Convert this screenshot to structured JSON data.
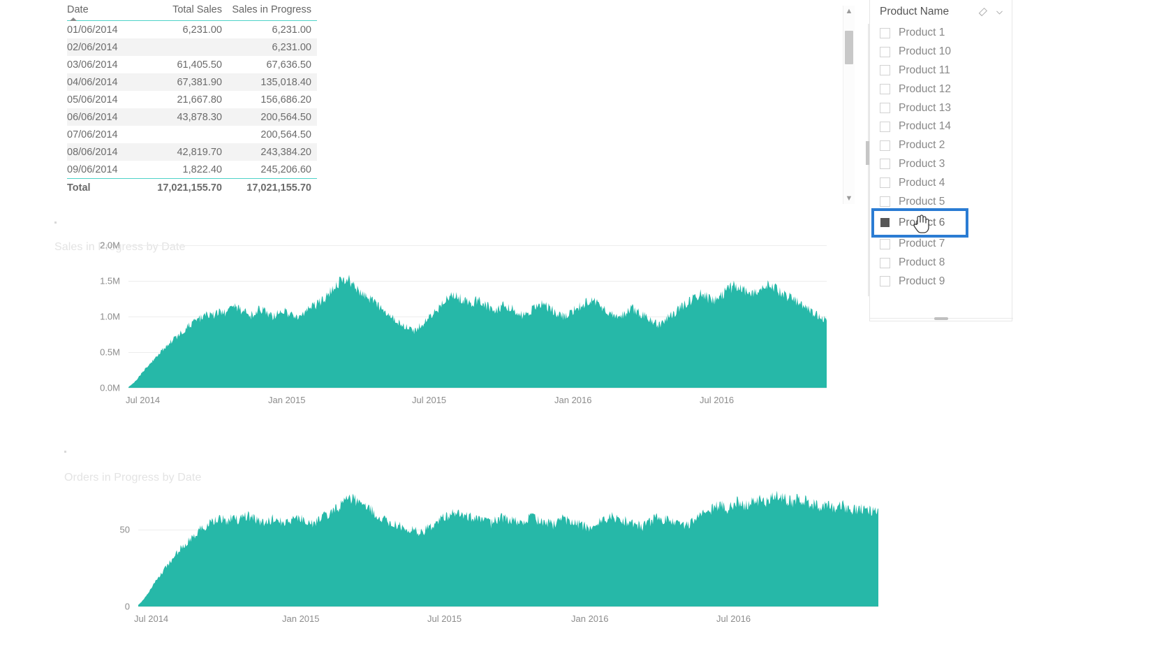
{
  "table": {
    "name": "sales-detail-table",
    "columns": [
      "Date",
      "Total Sales",
      "Sales in Progress"
    ],
    "rows": [
      {
        "date": "01/06/2014",
        "total_sales": "6,231.00",
        "sales_in_progress": "6,231.00"
      },
      {
        "date": "02/06/2014",
        "total_sales": "",
        "sales_in_progress": "6,231.00"
      },
      {
        "date": "03/06/2014",
        "total_sales": "61,405.50",
        "sales_in_progress": "67,636.50"
      },
      {
        "date": "04/06/2014",
        "total_sales": "67,381.90",
        "sales_in_progress": "135,018.40"
      },
      {
        "date": "05/06/2014",
        "total_sales": "21,667.80",
        "sales_in_progress": "156,686.20"
      },
      {
        "date": "06/06/2014",
        "total_sales": "43,878.30",
        "sales_in_progress": "200,564.50"
      },
      {
        "date": "07/06/2014",
        "total_sales": "",
        "sales_in_progress": "200,564.50"
      },
      {
        "date": "08/06/2014",
        "total_sales": "42,819.70",
        "sales_in_progress": "243,384.20"
      },
      {
        "date": "09/06/2014",
        "total_sales": "1,822.40",
        "sales_in_progress": "245,206.60"
      }
    ],
    "footer": {
      "label": "Total",
      "total_sales": "17,021,155.70",
      "sales_in_progress": "17,021,155.70"
    },
    "sort_column": "Date",
    "sort_direction": "ascending"
  },
  "slicer": {
    "title": "Product Name",
    "clear_icon": "eraser-icon",
    "expand_icon": "chevron-down-icon",
    "items": [
      {
        "label": "Product 1",
        "selected": false
      },
      {
        "label": "Product 10",
        "selected": false
      },
      {
        "label": "Product 11",
        "selected": false
      },
      {
        "label": "Product 12",
        "selected": false
      },
      {
        "label": "Product 13",
        "selected": false
      },
      {
        "label": "Product 14",
        "selected": false
      },
      {
        "label": "Product 2",
        "selected": false
      },
      {
        "label": "Product 3",
        "selected": false
      },
      {
        "label": "Product 4",
        "selected": false
      },
      {
        "label": "Product 5",
        "selected": false
      },
      {
        "label": "Product 6",
        "selected": true
      },
      {
        "label": "Product 7",
        "selected": false
      },
      {
        "label": "Product 8",
        "selected": false
      },
      {
        "label": "Product 9",
        "selected": false
      }
    ]
  },
  "colors": {
    "area_fill": "#26b8a8",
    "accent_rule": "#4ed3c8",
    "focus_outline": "#2b7cd3",
    "axis_text": "#8c8c8c",
    "title_text": "#e3e3e3"
  },
  "chart_data": [
    {
      "type": "area",
      "name": "sales-in-progress-chart",
      "title": "Sales in Progress by Date",
      "xlabel": "",
      "ylabel": "",
      "ylim": [
        0,
        2000000
      ],
      "yticks": [
        "0.0M",
        "0.5M",
        "1.0M",
        "1.5M",
        "2.0M"
      ],
      "ytick_values": [
        0,
        500000,
        1000000,
        1500000,
        2000000
      ],
      "xticks": [
        "Jul 2014",
        "Jan 2015",
        "Jul 2015",
        "Jan 2016",
        "Jul 2016"
      ],
      "grid": true,
      "legend": "none",
      "series": [
        {
          "name": "Sales in Progress",
          "values": [
            10000,
            60000,
            130000,
            210000,
            290000,
            360000,
            430000,
            500000,
            560000,
            620000,
            680000,
            730000,
            790000,
            850000,
            900000,
            940000,
            980000,
            1010000,
            1050000,
            1020000,
            1080000,
            1040000,
            1090000,
            1150000,
            1120000,
            1080000,
            1050000,
            1020000,
            1060000,
            1100000,
            1070000,
            1030000,
            1000000,
            1040000,
            1080000,
            1050000,
            1010000,
            980000,
            1020000,
            1060000,
            1100000,
            1150000,
            1190000,
            1240000,
            1300000,
            1380000,
            1450000,
            1520000,
            1560000,
            1480000,
            1420000,
            1350000,
            1300000,
            1250000,
            1200000,
            1150000,
            1100000,
            1050000,
            1000000,
            950000,
            900000,
            860000,
            830000,
            800000,
            850000,
            900000,
            960000,
            1020000,
            1090000,
            1150000,
            1220000,
            1280000,
            1300000,
            1260000,
            1220000,
            1180000,
            1200000,
            1230000,
            1190000,
            1150000,
            1110000,
            1080000,
            1120000,
            1160000,
            1130000,
            1090000,
            1050000,
            1020000,
            1060000,
            1100000,
            1140000,
            1180000,
            1150000,
            1110000,
            1070000,
            1030000,
            1000000,
            1040000,
            1080000,
            1120000,
            1160000,
            1200000,
            1240000,
            1200000,
            1150000,
            1100000,
            1060000,
            1020000,
            980000,
            1020000,
            1070000,
            1120000,
            1080000,
            1040000,
            1000000,
            960000,
            920000,
            880000,
            930000,
            980000,
            1030000,
            1080000,
            1130000,
            1180000,
            1230000,
            1280000,
            1330000,
            1290000,
            1250000,
            1210000,
            1260000,
            1310000,
            1360000,
            1410000,
            1450000,
            1400000,
            1350000,
            1300000,
            1340000,
            1380000,
            1420000,
            1460000,
            1420000,
            1380000,
            1340000,
            1300000,
            1260000,
            1220000,
            1180000,
            1140000,
            1100000,
            1060000,
            1020000,
            980000,
            940000
          ]
        }
      ]
    },
    {
      "type": "area",
      "name": "orders-in-progress-chart",
      "title": "Orders in Progress by Date",
      "xlabel": "",
      "ylabel": "",
      "ylim": [
        0,
        75
      ],
      "yticks": [
        "0",
        "50"
      ],
      "ytick_values": [
        0,
        50
      ],
      "xticks": [
        "Jul 2014",
        "Jan 2015",
        "Jul 2015",
        "Jan 2016",
        "Jul 2016"
      ],
      "grid": true,
      "legend": "none",
      "series": [
        {
          "name": "Orders in Progress",
          "values": [
            1,
            4,
            8,
            13,
            18,
            22,
            26,
            30,
            34,
            38,
            41,
            44,
            47,
            50,
            52,
            54,
            55,
            56,
            57,
            55,
            58,
            56,
            57,
            59,
            58,
            56,
            55,
            54,
            56,
            58,
            56,
            55,
            54,
            56,
            58,
            56,
            55,
            54,
            56,
            58,
            60,
            62,
            64,
            66,
            68,
            70,
            69,
            67,
            65,
            63,
            61,
            59,
            57,
            55,
            54,
            53,
            52,
            51,
            50,
            49,
            48,
            50,
            52,
            54,
            56,
            58,
            60,
            62,
            61,
            60,
            59,
            58,
            57,
            56,
            55,
            54,
            56,
            58,
            57,
            56,
            55,
            54,
            56,
            58,
            57,
            56,
            55,
            54,
            53,
            55,
            57,
            56,
            55,
            54,
            53,
            52,
            51,
            53,
            55,
            57,
            59,
            58,
            57,
            56,
            55,
            54,
            53,
            52,
            54,
            56,
            58,
            57,
            56,
            55,
            54,
            53,
            52,
            54,
            56,
            58,
            60,
            62,
            64,
            66,
            65,
            64,
            66,
            68,
            67,
            66,
            68,
            70,
            69,
            68,
            70,
            72,
            71,
            70,
            69,
            68,
            70,
            69,
            68,
            67,
            66,
            65,
            66,
            65,
            64,
            66,
            65,
            64,
            63,
            64,
            63,
            62,
            63,
            62
          ]
        }
      ]
    }
  ]
}
